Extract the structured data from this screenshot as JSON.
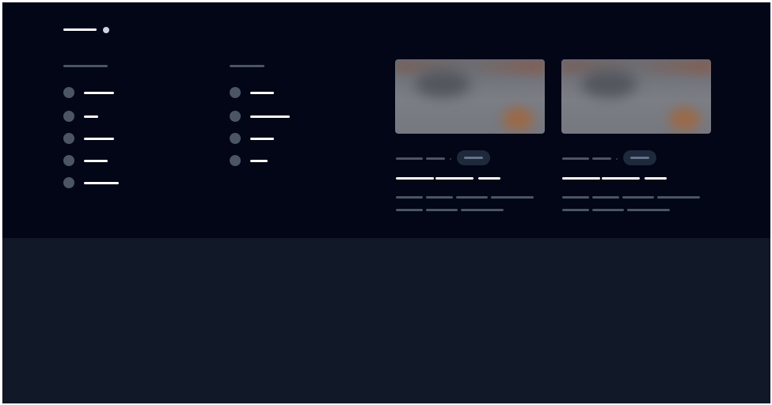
{
  "theme": {
    "footer_bg": "#020617",
    "page_bg": "#111827",
    "skeleton_light": "#ffffff",
    "skeleton_muted": "#4b5563"
  },
  "brand": {
    "logo_icon": "circle-dot-icon"
  },
  "footer": {
    "columns": [
      {
        "heading": "",
        "items": [
          "",
          "",
          "",
          "",
          ""
        ]
      },
      {
        "heading": "",
        "items": [
          "",
          "",
          "",
          ""
        ]
      }
    ],
    "cards": [
      {
        "thumbnail": "blurred-image",
        "meta": "",
        "tag": "",
        "title": "",
        "excerpt": ""
      },
      {
        "thumbnail": "blurred-image",
        "meta": "",
        "tag": "",
        "title": "",
        "excerpt": ""
      }
    ]
  }
}
